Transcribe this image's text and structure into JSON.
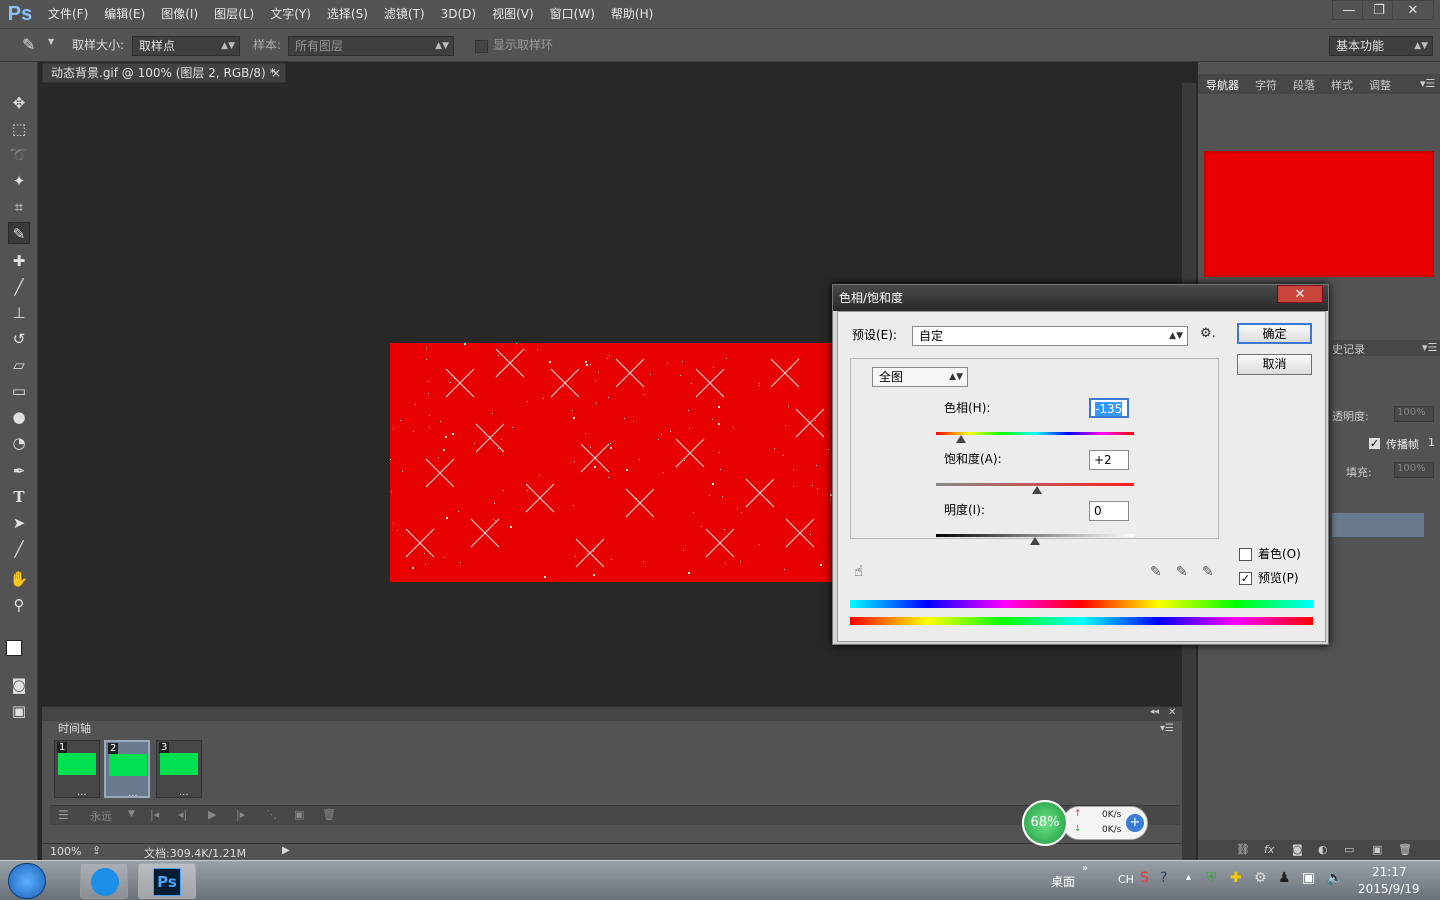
{
  "app": {
    "logo": "Ps"
  },
  "menubar": {
    "items": [
      "文件(F)",
      "编辑(E)",
      "图像(I)",
      "图层(L)",
      "文字(Y)",
      "选择(S)",
      "滤镜(T)",
      "3D(D)",
      "视图(V)",
      "窗口(W)",
      "帮助(H)"
    ],
    "window_buttons": [
      "—",
      "❐",
      "✕"
    ]
  },
  "options": {
    "sample_size_label": "取样大小:",
    "sample_size_value": "取样点",
    "sample_label": "样本:",
    "sample_value": "所有图层",
    "show_ring_label": "显示取样环",
    "workspace": "基本功能"
  },
  "document": {
    "tab_title": "动态背景.gif @ 100% (图层 2, RGB/8) *",
    "tab_close": "×"
  },
  "timeline": {
    "title": "时间轴",
    "frames": [
      {
        "num": "1",
        "duration": "..."
      },
      {
        "num": "2",
        "duration": "..."
      },
      {
        "num": "3",
        "duration": "..."
      }
    ],
    "loop_label": "永远"
  },
  "status": {
    "zoom": "100%",
    "doc_info": "文档:309.4K/1.21M"
  },
  "right_panel": {
    "tabs": [
      "导航器",
      "字符",
      "段落",
      "样式",
      "调整"
    ],
    "history_label": "史记录",
    "opacity_label": "透明度:",
    "opacity_value": "100%",
    "propagate_label": "传播帧",
    "propagate_num": "1",
    "fill_label": "填充:",
    "fill_value": "100%"
  },
  "dialog": {
    "title": "色相/饱和度",
    "close": "✕",
    "preset_label": "预设(E):",
    "preset_value": "自定",
    "channel_value": "全图",
    "hue_label": "色相(H):",
    "hue_value": "-135",
    "saturation_label": "饱和度(A):",
    "saturation_value": "+2",
    "lightness_label": "明度(I):",
    "lightness_value": "0",
    "ok_label": "确定",
    "cancel_label": "取消",
    "colorize_label": "着色(O)",
    "preview_label": "预览(P)"
  },
  "net_widget": {
    "percent": "68%",
    "up": "0K/s",
    "down": "0K/s"
  },
  "taskbar": {
    "desktop_label": "桌面",
    "lang": "CH",
    "time": "21:17",
    "date": "2015/9/19",
    "ps_label": "Ps"
  },
  "colors": {
    "canvas_red": "#e60000",
    "frame_green": "#00e050",
    "ui_gray": "#535353"
  }
}
